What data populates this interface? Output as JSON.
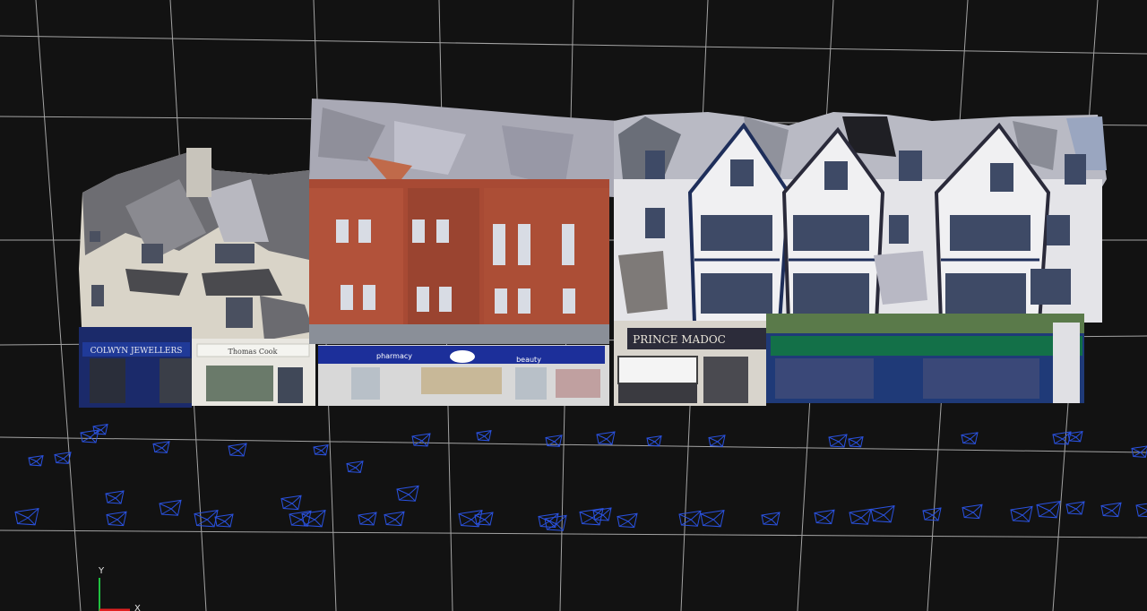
{
  "viewer": {
    "background_color": "#121212",
    "grid_color": "#c8c8c8",
    "camera_frustum_color": "#2a52e0"
  },
  "model": {
    "storefront_signs": [
      {
        "text": "COLWYN JEWELLERS",
        "color": "#2a3f8f"
      },
      {
        "text": "Thomas Cook",
        "color": "#f0f0ee"
      },
      {
        "text": "pharmacy",
        "color": "#1b2f9a"
      },
      {
        "text": "beauty",
        "color": "#1b2f9a"
      },
      {
        "text": "PRINCE MADOC",
        "color": "#2c2c3a"
      }
    ]
  },
  "axes": {
    "y_label": "Y",
    "x_label": "X",
    "x_color": "#e02020",
    "y_color": "#20c040"
  }
}
